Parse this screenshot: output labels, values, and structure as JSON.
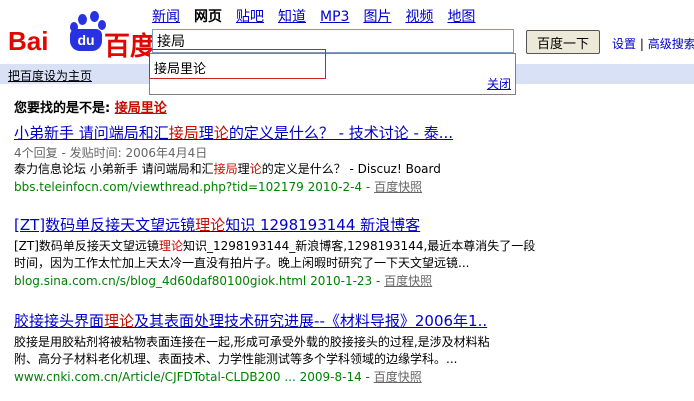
{
  "logo": {
    "text_left": "Bai",
    "text_du": "du",
    "text_right": "百度"
  },
  "nav": {
    "items": [
      "新闻",
      "网页",
      "贴吧",
      "知道",
      "MP3",
      "图片",
      "视频",
      "地图"
    ],
    "current_index": 1
  },
  "search": {
    "query": "接局",
    "button_label": "百度一下"
  },
  "top_links": {
    "settings": "设置",
    "sep": "|",
    "advanced": "高级搜索"
  },
  "suggest": {
    "item": "接局里论",
    "close": "关闭"
  },
  "sethome": "把百度设为主页",
  "did_you_mean": {
    "prefix": "您要找的是不是: ",
    "term": "接局里论"
  },
  "results": [
    {
      "title_pre": "小弟新手  请问端局和汇",
      "title_hl1": "接局",
      "title_mid": "理",
      "title_hl2": "论",
      "title_post": "的定义是什么？  - 技术讨论 - 泰...",
      "meta": "4个回复 - 发贴时间: 2006年4月4日",
      "snip1_pre": "泰力信息论坛  小弟新手  请问端局和汇",
      "snip1_hl": "接局",
      "snip1_mid": "理",
      "snip1_hl2": "论",
      "snip1_post": "的定义是什么？  - Discuz! Board",
      "snip2": "",
      "url": "bbs.teleinfocn.com/viewthread.php?tid=102179 2010-2-4",
      "snapshot": "百度快照"
    },
    {
      "title_pre": "[ZT]数码单反接天文望远镜",
      "title_hl1": "理",
      "title_mid": "",
      "title_hl2": "论",
      "title_post": "知识  1298193144  新浪博客",
      "snip1_pre": "[ZT]数码单反接天文望远镜",
      "snip1_hl": "理",
      "snip1_mid": "",
      "snip1_hl2": "论",
      "snip1_post": "知识_1298193144_新浪博客,1298193144,最近本尊消失了一段",
      "snip2": "时间，因为工作太忙加上天太冷一直没有拍片子。晚上闲暇时研究了一下天文望远镜...",
      "url": "blog.sina.com.cn/s/blog_4d60daf80100giok.html 2010-1-23",
      "snapshot": "百度快照"
    },
    {
      "title_pre": "胶接接头界面",
      "title_hl1": "理",
      "title_mid": "",
      "title_hl2": "论",
      "title_post": "及其表面处理技术研究进展--《材料导报》2006年1..",
      "snip1_pre": "胶接是用胶粘剂将被粘物表面连接在一起,形成可承受外载的胶接接头的过程,是涉及材料粘",
      "snip1_hl": "",
      "snip1_mid": "",
      "snip1_hl2": "",
      "snip1_post": "",
      "snip2": "附、高分子材料老化机理、表面技术、力学性能测试等多个学科领域的边缘学科。...",
      "url": "www.cnki.com.cn/Article/CJFDTotal-CLDB200 ... 2009-8-14",
      "snapshot": "百度快照"
    }
  ],
  "colors": {
    "brand_red": "#e10602",
    "brand_blue": "#2932e1",
    "link": "#0000cc",
    "url_green": "#008000",
    "highlight": "#c60a00",
    "bar": "#d9e1f7"
  }
}
